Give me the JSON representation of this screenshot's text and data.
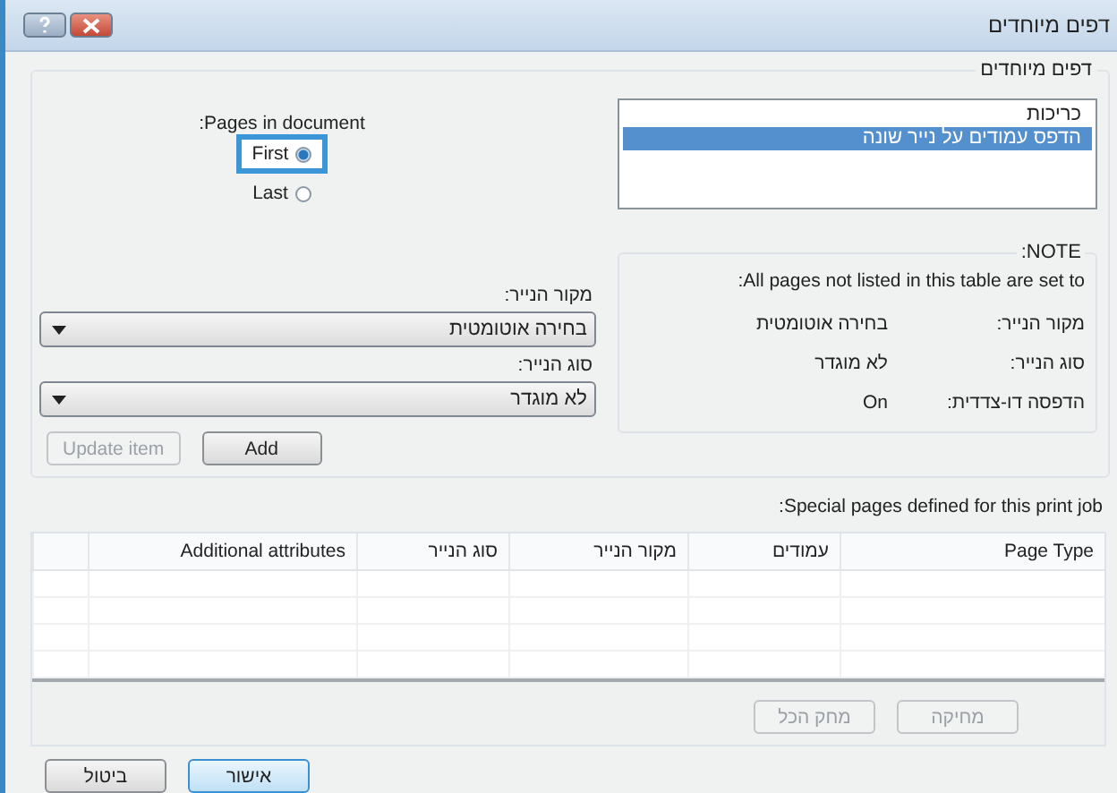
{
  "window": {
    "title": "דפים מיוחדים"
  },
  "group": {
    "title": "דפים מיוחדים"
  },
  "page_types": [
    {
      "label": "כריכות",
      "selected": false
    },
    {
      "label": "הדפס עמודים על נייר שונה",
      "selected": true
    }
  ],
  "pages_in_document": {
    "label": ":Pages in document",
    "options": [
      {
        "label": "First",
        "selected": true,
        "focused": true
      },
      {
        "label": "Last",
        "selected": false,
        "focused": false
      }
    ]
  },
  "note": {
    "title": ":NOTE",
    "text": ":All pages not listed in this table are set to",
    "rows": [
      {
        "label": "מקור הנייר:",
        "value": "בחירה אוטומטית"
      },
      {
        "label": "סוג הנייר:",
        "value": "לא מוגדר"
      },
      {
        "label": "הדפסה דו-צדדית:",
        "value": "On"
      }
    ]
  },
  "fields": [
    {
      "label": "מקור הנייר:",
      "value": "בחירה אוטומטית"
    },
    {
      "label": "סוג הנייר:",
      "value": "לא מוגדר"
    }
  ],
  "item_buttons": [
    {
      "label": "Add",
      "disabled": false
    },
    {
      "label": "Update item",
      "disabled": true
    }
  ],
  "table": {
    "caption": ":Special pages defined for this print job",
    "columns": [
      "Page Type",
      "עמודים",
      "מקור הנייר",
      "סוג הנייר",
      "Additional attributes"
    ]
  },
  "table_buttons": [
    {
      "label": "מחיקה",
      "disabled": true
    },
    {
      "label": "מחק הכל",
      "disabled": true
    }
  ],
  "dialog_buttons": [
    {
      "label": "אישור",
      "disabled": false,
      "default": true
    },
    {
      "label": "ביטול",
      "disabled": false,
      "default": false
    }
  ]
}
